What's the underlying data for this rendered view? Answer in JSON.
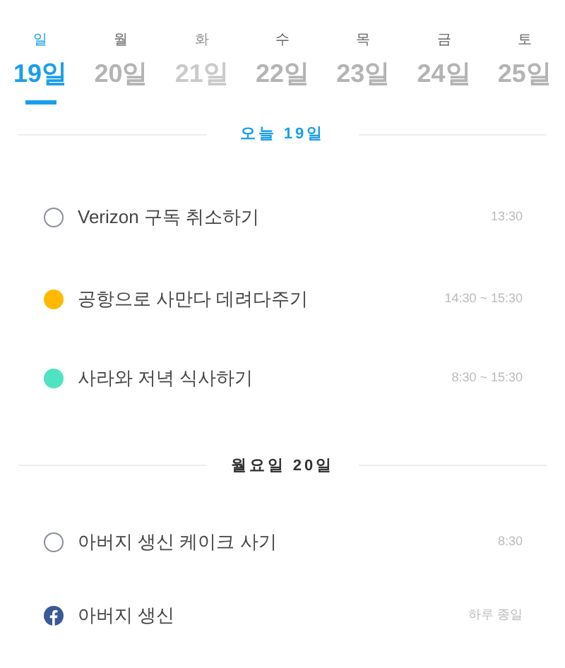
{
  "days": [
    {
      "weekday": "일",
      "date": "19일",
      "selected": true,
      "muted": false
    },
    {
      "weekday": "월",
      "date": "20일",
      "selected": false,
      "muted": false
    },
    {
      "weekday": "화",
      "date": "21일",
      "selected": false,
      "muted": true
    },
    {
      "weekday": "수",
      "date": "22일",
      "selected": false,
      "muted": false
    },
    {
      "weekday": "목",
      "date": "23일",
      "selected": false,
      "muted": false
    },
    {
      "weekday": "금",
      "date": "24일",
      "selected": false,
      "muted": false
    },
    {
      "weekday": "토",
      "date": "25일",
      "selected": false,
      "muted": false
    }
  ],
  "sections": [
    {
      "title": "오늘 19일",
      "today": true,
      "events": [
        {
          "kind": "task",
          "title": "Verizon 구독 취소하기",
          "time": "13:30"
        },
        {
          "kind": "event",
          "color": "#ffb900",
          "title": "공항으로 사만다 데려다주기",
          "time": "14:30 ~ 15:30"
        },
        {
          "kind": "event",
          "color": "#50e3c2",
          "title": "사라와 저녁 식사하기",
          "time": "8:30 ~ 15:30"
        }
      ]
    },
    {
      "title": "월요일 20일",
      "today": false,
      "events": [
        {
          "kind": "task",
          "title": "아버지 생신 케이크 사기",
          "time": "8:30"
        },
        {
          "kind": "facebook",
          "title": "아버지 생신",
          "time": "하루 종일"
        }
      ]
    }
  ]
}
